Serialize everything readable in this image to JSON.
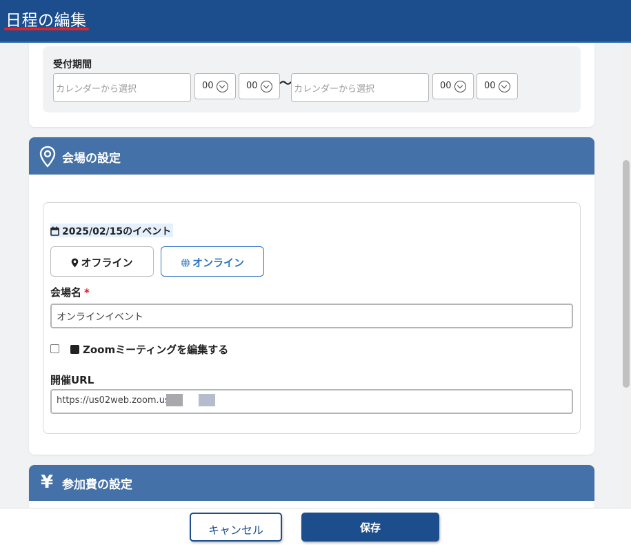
{
  "header": {
    "title": "日程の編集"
  },
  "reception": {
    "label": "受付期間",
    "start_date_placeholder": "カレンダーから選択",
    "start_hour": "00",
    "start_minute": "00",
    "separator": "〜",
    "end_date_placeholder": "カレンダーから選択",
    "end_hour": "00",
    "end_minute": "00"
  },
  "venue_section": {
    "title": "会場の設定",
    "event_date_label": "2025/02/15のイベント",
    "offline_label": "オフライン",
    "online_label": "オンライン",
    "selected_mode": "online",
    "venue_name_label": "会場名",
    "required_mark": "*",
    "venue_name_value": "オンラインイベント",
    "zoom_checkbox_label": "Zoomミーティングを編集する",
    "zoom_checked": false,
    "url_label": "開催URL",
    "url_value": "https://us02web.zoom.us/"
  },
  "fee_section": {
    "title": "参加費の設定"
  },
  "footer": {
    "cancel_label": "キャンセル",
    "save_label": "保存"
  },
  "colors": {
    "header_bg": "#1c4e8d",
    "section_header_bg": "#4471a7",
    "accent": "#2d74c4",
    "required": "#d0242b"
  }
}
